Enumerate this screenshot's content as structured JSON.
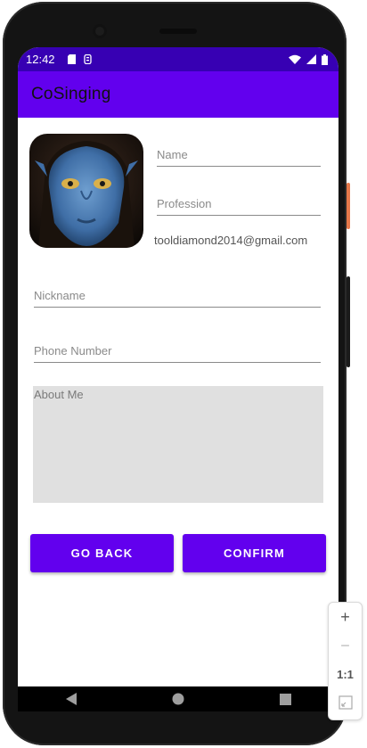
{
  "status_bar": {
    "time": "12:42",
    "left_icons": [
      "sd-card-icon",
      "notification-icon"
    ],
    "right_icons": [
      "wifi-icon",
      "signal-icon",
      "battery-icon"
    ]
  },
  "app_bar": {
    "title": "CoSinging"
  },
  "colors": {
    "primary": "#6200ee",
    "primary_dark": "#3700b3",
    "about_bg": "#e0e0e0"
  },
  "profile": {
    "avatar_icon": "avatar",
    "name_placeholder": "Name",
    "profession_placeholder": "Profession",
    "email": "tooldiamond2014@gmail.com"
  },
  "form": {
    "nickname_placeholder": "Nickname",
    "phone_placeholder": "Phone Number",
    "about_placeholder": "About Me"
  },
  "buttons": {
    "go_back": "GO BACK",
    "confirm": "CONFIRM"
  },
  "zoom": {
    "plus": "+",
    "minus": "−",
    "ratio": "1:1"
  }
}
